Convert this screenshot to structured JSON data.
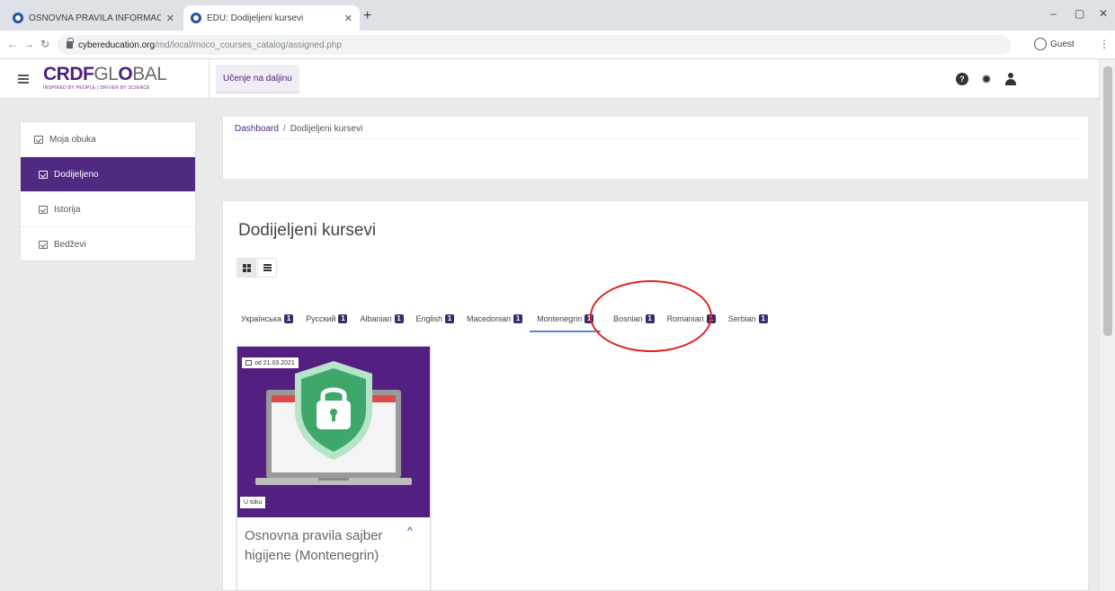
{
  "browser": {
    "tabs": [
      {
        "title": "OSNOVNA PRAVILA INFORMAC",
        "active": false
      },
      {
        "title": "EDU: Dodijeljeni kursevi",
        "active": true
      }
    ],
    "url_host": "cybereducation.org",
    "url_path": "/md/local/moco_courses_catalog/assigned.php",
    "profile_label": "Guest"
  },
  "header": {
    "logo_main": "CRDF",
    "logo_light": "GL",
    "logo_o": "O",
    "logo_end": "BAL",
    "logo_tagline": "INSPIRED BY PEOPLE | DRIVEN BY SCIENCE",
    "nav_link": "Učenje na daljinu"
  },
  "sidebar": {
    "items": [
      {
        "label": "Moja obuka"
      },
      {
        "label": "Dodijeljeno"
      },
      {
        "label": "Istorija"
      },
      {
        "label": "Bedževi"
      }
    ]
  },
  "breadcrumb": {
    "home": "Dashboard",
    "separator": "/",
    "current": "Dodijeljeni kursevi"
  },
  "main": {
    "title": "Dodijeljeni kursevi",
    "language_tabs": [
      {
        "label": "Українська",
        "count": "1"
      },
      {
        "label": "Русский",
        "count": "1"
      },
      {
        "label": "Albanian",
        "count": "1"
      },
      {
        "label": "English",
        "count": "1"
      },
      {
        "label": "Macedonian",
        "count": "1"
      },
      {
        "label": "Montenegrin",
        "count": "1"
      },
      {
        "label": "Bosnian",
        "count": "1"
      },
      {
        "label": "Romanian",
        "count": "1"
      },
      {
        "label": "Serbian",
        "count": "1"
      }
    ],
    "selected_language": "Montenegrin"
  },
  "course_card": {
    "date": "od 21.03.2021",
    "status": "U toku",
    "title": "Osnovna pravila sajber higijene (Montenegrin)"
  },
  "colors": {
    "brand_purple": "#4f2a80",
    "annotation_red": "#e02020",
    "shield_green": "#3ea86a"
  }
}
